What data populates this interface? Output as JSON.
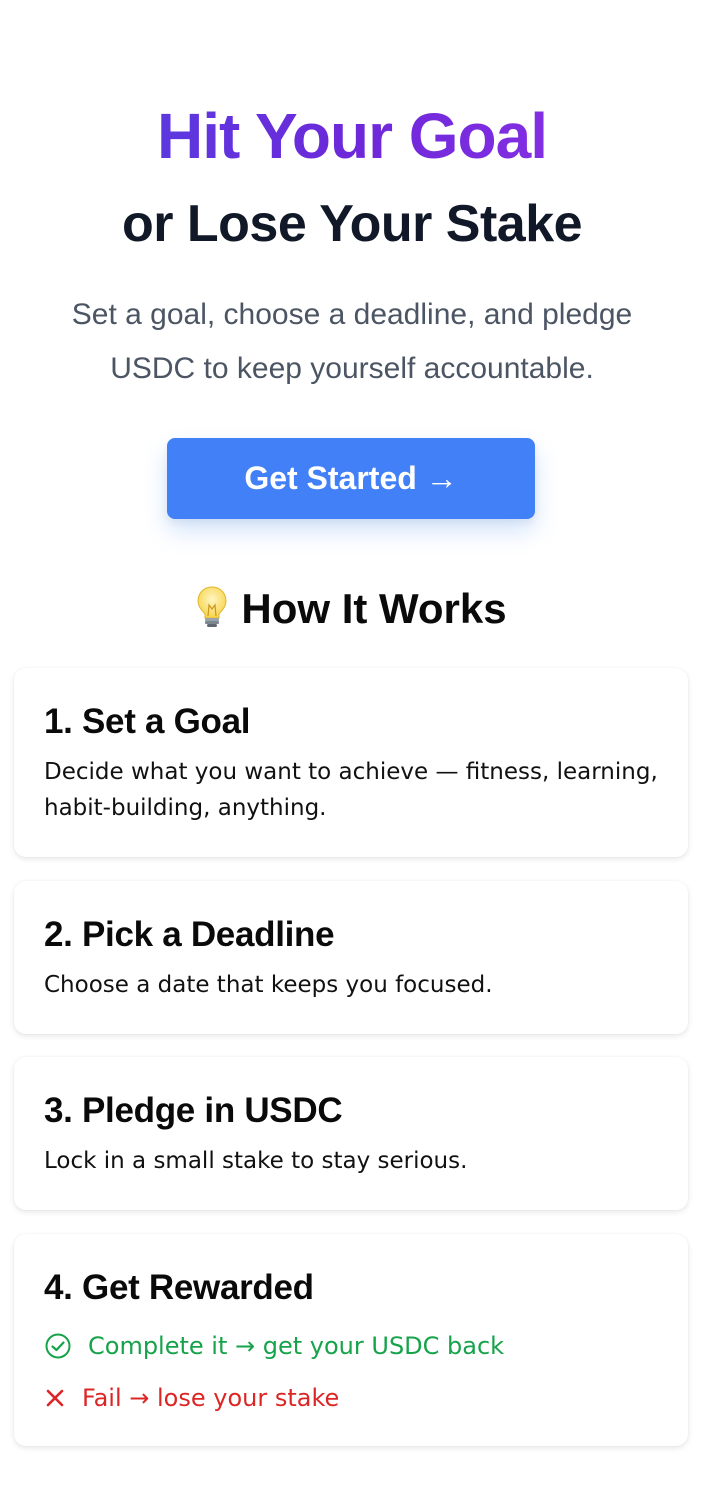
{
  "hero": {
    "headline_gradient": "Hit Your Goal",
    "headline_sub": "or Lose Your Stake",
    "subtitle": "Set a goal, choose a deadline, and pledge USDC to keep yourself accountable.",
    "cta_label": "Get Started →"
  },
  "how_it_works": {
    "icon": "lightbulb-icon",
    "title": "How It Works",
    "steps": [
      {
        "title": "1. Set a Goal",
        "description": "Decide what you want to achieve — fitness, learning, habit-building, anything."
      },
      {
        "title": "2. Pick a Deadline",
        "description": "Choose a date that keeps you focused."
      },
      {
        "title": "3. Pledge in USDC",
        "description": "Lock in a small stake to stay serious."
      },
      {
        "title": "4. Get Rewarded",
        "outcomes": {
          "success": {
            "icon": "check-circle-icon",
            "text": "Complete it → get your USDC back"
          },
          "fail": {
            "icon": "x-icon",
            "text": "Fail → lose your stake"
          }
        }
      }
    ]
  },
  "colors": {
    "gradient_start": "#4f46e5",
    "gradient_end": "#9333ea",
    "cta": "#4180f6",
    "success": "#16a34a",
    "fail": "#dc2626"
  }
}
